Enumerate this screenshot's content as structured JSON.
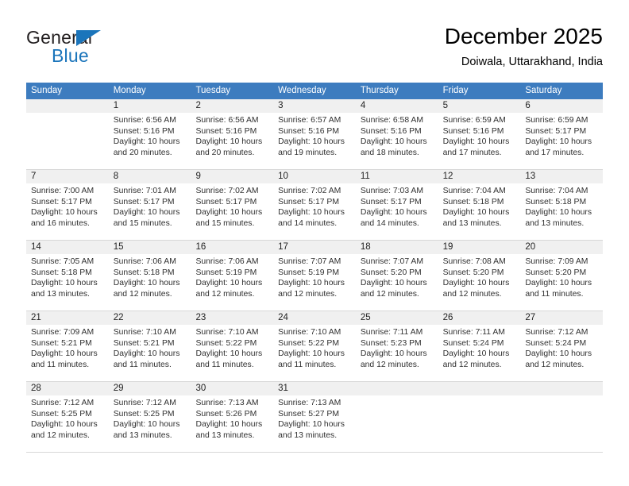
{
  "logo": {
    "word_dark": "General",
    "word_blue": "Blue",
    "accent_color": "#1b75bb"
  },
  "header": {
    "title": "December 2025",
    "subtitle": "Doiwala, Uttarakhand, India"
  },
  "calendar": {
    "header_bg": "#3d7cbf",
    "daynum_band_bg": "#f0f0f0",
    "weekday_names": [
      "Sunday",
      "Monday",
      "Tuesday",
      "Wednesday",
      "Thursday",
      "Friday",
      "Saturday"
    ],
    "weeks": [
      [
        {
          "day": "",
          "lines": []
        },
        {
          "day": "1",
          "lines": [
            "Sunrise: 6:56 AM",
            "Sunset: 5:16 PM",
            "Daylight: 10 hours",
            "and 20 minutes."
          ]
        },
        {
          "day": "2",
          "lines": [
            "Sunrise: 6:56 AM",
            "Sunset: 5:16 PM",
            "Daylight: 10 hours",
            "and 20 minutes."
          ]
        },
        {
          "day": "3",
          "lines": [
            "Sunrise: 6:57 AM",
            "Sunset: 5:16 PM",
            "Daylight: 10 hours",
            "and 19 minutes."
          ]
        },
        {
          "day": "4",
          "lines": [
            "Sunrise: 6:58 AM",
            "Sunset: 5:16 PM",
            "Daylight: 10 hours",
            "and 18 minutes."
          ]
        },
        {
          "day": "5",
          "lines": [
            "Sunrise: 6:59 AM",
            "Sunset: 5:16 PM",
            "Daylight: 10 hours",
            "and 17 minutes."
          ]
        },
        {
          "day": "6",
          "lines": [
            "Sunrise: 6:59 AM",
            "Sunset: 5:17 PM",
            "Daylight: 10 hours",
            "and 17 minutes."
          ]
        }
      ],
      [
        {
          "day": "7",
          "lines": [
            "Sunrise: 7:00 AM",
            "Sunset: 5:17 PM",
            "Daylight: 10 hours",
            "and 16 minutes."
          ]
        },
        {
          "day": "8",
          "lines": [
            "Sunrise: 7:01 AM",
            "Sunset: 5:17 PM",
            "Daylight: 10 hours",
            "and 15 minutes."
          ]
        },
        {
          "day": "9",
          "lines": [
            "Sunrise: 7:02 AM",
            "Sunset: 5:17 PM",
            "Daylight: 10 hours",
            "and 15 minutes."
          ]
        },
        {
          "day": "10",
          "lines": [
            "Sunrise: 7:02 AM",
            "Sunset: 5:17 PM",
            "Daylight: 10 hours",
            "and 14 minutes."
          ]
        },
        {
          "day": "11",
          "lines": [
            "Sunrise: 7:03 AM",
            "Sunset: 5:17 PM",
            "Daylight: 10 hours",
            "and 14 minutes."
          ]
        },
        {
          "day": "12",
          "lines": [
            "Sunrise: 7:04 AM",
            "Sunset: 5:18 PM",
            "Daylight: 10 hours",
            "and 13 minutes."
          ]
        },
        {
          "day": "13",
          "lines": [
            "Sunrise: 7:04 AM",
            "Sunset: 5:18 PM",
            "Daylight: 10 hours",
            "and 13 minutes."
          ]
        }
      ],
      [
        {
          "day": "14",
          "lines": [
            "Sunrise: 7:05 AM",
            "Sunset: 5:18 PM",
            "Daylight: 10 hours",
            "and 13 minutes."
          ]
        },
        {
          "day": "15",
          "lines": [
            "Sunrise: 7:06 AM",
            "Sunset: 5:18 PM",
            "Daylight: 10 hours",
            "and 12 minutes."
          ]
        },
        {
          "day": "16",
          "lines": [
            "Sunrise: 7:06 AM",
            "Sunset: 5:19 PM",
            "Daylight: 10 hours",
            "and 12 minutes."
          ]
        },
        {
          "day": "17",
          "lines": [
            "Sunrise: 7:07 AM",
            "Sunset: 5:19 PM",
            "Daylight: 10 hours",
            "and 12 minutes."
          ]
        },
        {
          "day": "18",
          "lines": [
            "Sunrise: 7:07 AM",
            "Sunset: 5:20 PM",
            "Daylight: 10 hours",
            "and 12 minutes."
          ]
        },
        {
          "day": "19",
          "lines": [
            "Sunrise: 7:08 AM",
            "Sunset: 5:20 PM",
            "Daylight: 10 hours",
            "and 12 minutes."
          ]
        },
        {
          "day": "20",
          "lines": [
            "Sunrise: 7:09 AM",
            "Sunset: 5:20 PM",
            "Daylight: 10 hours",
            "and 11 minutes."
          ]
        }
      ],
      [
        {
          "day": "21",
          "lines": [
            "Sunrise: 7:09 AM",
            "Sunset: 5:21 PM",
            "Daylight: 10 hours",
            "and 11 minutes."
          ]
        },
        {
          "day": "22",
          "lines": [
            "Sunrise: 7:10 AM",
            "Sunset: 5:21 PM",
            "Daylight: 10 hours",
            "and 11 minutes."
          ]
        },
        {
          "day": "23",
          "lines": [
            "Sunrise: 7:10 AM",
            "Sunset: 5:22 PM",
            "Daylight: 10 hours",
            "and 11 minutes."
          ]
        },
        {
          "day": "24",
          "lines": [
            "Sunrise: 7:10 AM",
            "Sunset: 5:22 PM",
            "Daylight: 10 hours",
            "and 11 minutes."
          ]
        },
        {
          "day": "25",
          "lines": [
            "Sunrise: 7:11 AM",
            "Sunset: 5:23 PM",
            "Daylight: 10 hours",
            "and 12 minutes."
          ]
        },
        {
          "day": "26",
          "lines": [
            "Sunrise: 7:11 AM",
            "Sunset: 5:24 PM",
            "Daylight: 10 hours",
            "and 12 minutes."
          ]
        },
        {
          "day": "27",
          "lines": [
            "Sunrise: 7:12 AM",
            "Sunset: 5:24 PM",
            "Daylight: 10 hours",
            "and 12 minutes."
          ]
        }
      ],
      [
        {
          "day": "28",
          "lines": [
            "Sunrise: 7:12 AM",
            "Sunset: 5:25 PM",
            "Daylight: 10 hours",
            "and 12 minutes."
          ]
        },
        {
          "day": "29",
          "lines": [
            "Sunrise: 7:12 AM",
            "Sunset: 5:25 PM",
            "Daylight: 10 hours",
            "and 13 minutes."
          ]
        },
        {
          "day": "30",
          "lines": [
            "Sunrise: 7:13 AM",
            "Sunset: 5:26 PM",
            "Daylight: 10 hours",
            "and 13 minutes."
          ]
        },
        {
          "day": "31",
          "lines": [
            "Sunrise: 7:13 AM",
            "Sunset: 5:27 PM",
            "Daylight: 10 hours",
            "and 13 minutes."
          ]
        },
        {
          "day": "",
          "lines": []
        },
        {
          "day": "",
          "lines": []
        },
        {
          "day": "",
          "lines": []
        }
      ]
    ]
  }
}
